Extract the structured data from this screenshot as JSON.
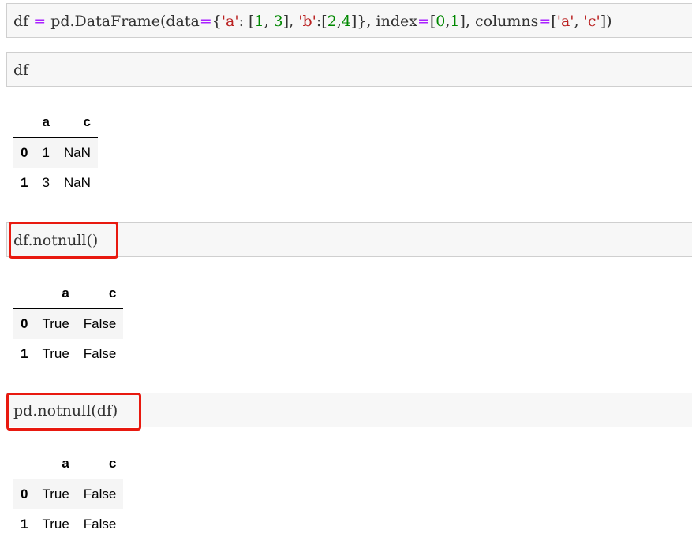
{
  "cells": [
    {
      "code_tokens": [
        {
          "t": "df ",
          "c": ""
        },
        {
          "t": "=",
          "c": "op"
        },
        {
          "t": " pd.DataFrame(data",
          "c": ""
        },
        {
          "t": "=",
          "c": "op"
        },
        {
          "t": "{",
          "c": ""
        },
        {
          "t": "'a'",
          "c": "str"
        },
        {
          "t": ": [",
          "c": ""
        },
        {
          "t": "1",
          "c": "num"
        },
        {
          "t": ", ",
          "c": ""
        },
        {
          "t": "3",
          "c": "num"
        },
        {
          "t": "], ",
          "c": ""
        },
        {
          "t": "'b'",
          "c": "str"
        },
        {
          "t": ":[",
          "c": ""
        },
        {
          "t": "2",
          "c": "num"
        },
        {
          "t": ",",
          "c": ""
        },
        {
          "t": "4",
          "c": "num"
        },
        {
          "t": "]}, index",
          "c": ""
        },
        {
          "t": "=",
          "c": "op"
        },
        {
          "t": "[",
          "c": ""
        },
        {
          "t": "0",
          "c": "num"
        },
        {
          "t": ",",
          "c": ""
        },
        {
          "t": "1",
          "c": "num"
        },
        {
          "t": "], columns",
          "c": ""
        },
        {
          "t": "=",
          "c": "op"
        },
        {
          "t": "[",
          "c": ""
        },
        {
          "t": "'a'",
          "c": "str"
        },
        {
          "t": ", ",
          "c": ""
        },
        {
          "t": "'c'",
          "c": "str"
        },
        {
          "t": "])",
          "c": ""
        }
      ]
    },
    {
      "code": "df"
    },
    {
      "code": "df.notnull()",
      "output": {
        "columns": [
          "a",
          "c"
        ],
        "rows": [
          {
            "index": "0",
            "values": [
              "True",
              "False"
            ]
          },
          {
            "index": "1",
            "values": [
              "True",
              "False"
            ]
          }
        ]
      }
    },
    {
      "code": "pd.notnull(df)",
      "output": {
        "columns": [
          "a",
          "c"
        ],
        "rows": [
          {
            "index": "0",
            "values": [
              "True",
              "False"
            ]
          },
          {
            "index": "1",
            "values": [
              "True",
              "False"
            ]
          }
        ]
      }
    }
  ],
  "df_output": {
    "columns": [
      "a",
      "c"
    ],
    "rows": [
      {
        "index": "0",
        "values": [
          "1",
          "NaN"
        ]
      },
      {
        "index": "1",
        "values": [
          "3",
          "NaN"
        ]
      }
    ]
  },
  "colors": {
    "highlight": "#e8190f",
    "cell_bg": "#f7f7f7",
    "row_stripe": "#f5f5f5"
  }
}
